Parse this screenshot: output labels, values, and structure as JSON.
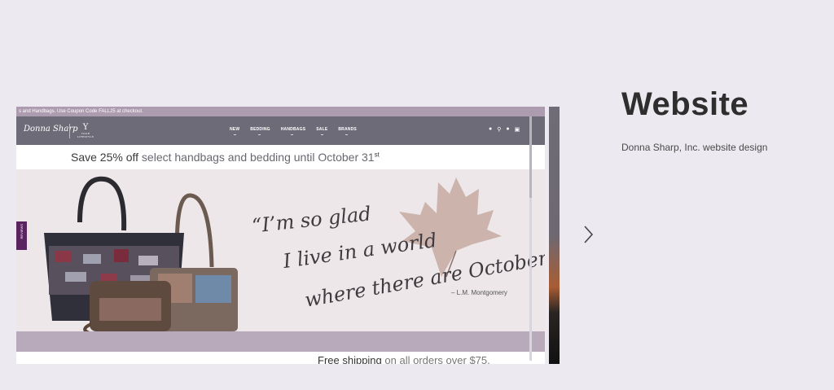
{
  "screenshot": {
    "topbar_text": "s and Handbags. Use Coupon Code FALL25 at checkout.",
    "logo_primary": "Donna Sharp",
    "logo_secondary_mark": "Y",
    "logo_secondary_text": "YOUR LIFESTYLE",
    "nav_items": [
      "NEW",
      "BEDDING",
      "HANDBAGS",
      "SALE",
      "BRANDS"
    ],
    "promo": {
      "bold": "Save 25% off",
      "middle": " select handbags and bedding until October 31",
      "suffix": "st"
    },
    "review_tab": "REVIEWS",
    "quote_lines": [
      "“I’m so glad",
      "I live in a world",
      "where there are Octobers.”"
    ],
    "attribution": "– L.M. Montgomery",
    "free_shipping": {
      "bold": "Free shipping",
      "rest": " on all orders over $75."
    }
  },
  "project": {
    "title": "Website",
    "description": "Donna Sharp, Inc. website design"
  },
  "colors": {
    "page_bg": "#eceaf0",
    "nav_bg": "#6e6b78",
    "accent_purple": "#5b2460",
    "strip_purple": "#b8a9bb"
  }
}
